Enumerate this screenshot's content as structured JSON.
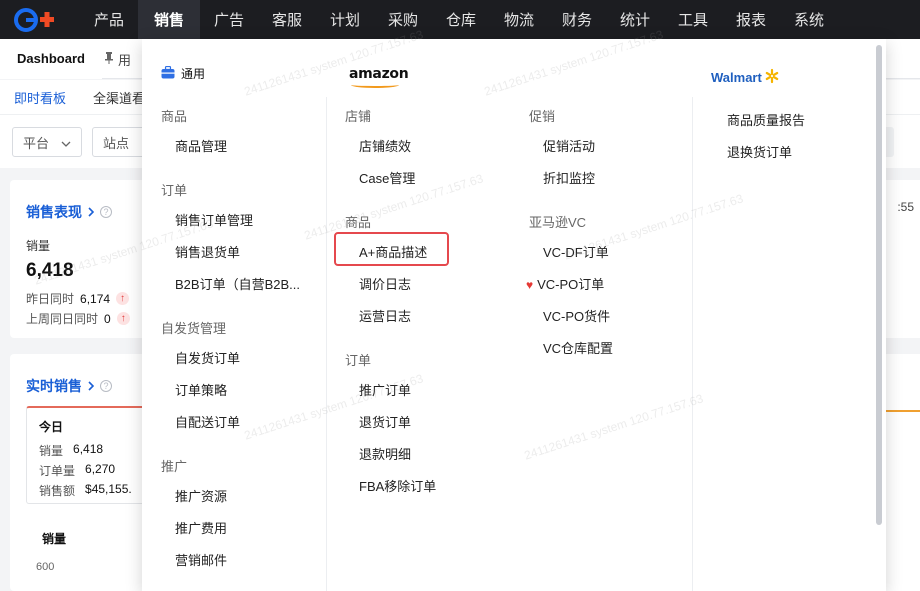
{
  "nav": {
    "items": [
      {
        "label": "产品",
        "active": false
      },
      {
        "label": "销售",
        "active": true
      },
      {
        "label": "广告",
        "active": false
      },
      {
        "label": "客服",
        "active": false
      },
      {
        "label": "计划",
        "active": false
      },
      {
        "label": "采购",
        "active": false
      },
      {
        "label": "仓库",
        "active": false
      },
      {
        "label": "物流",
        "active": false
      },
      {
        "label": "财务",
        "active": false
      },
      {
        "label": "统计",
        "active": false
      },
      {
        "label": "工具",
        "active": false
      },
      {
        "label": "报表",
        "active": false
      },
      {
        "label": "系统",
        "active": false
      }
    ]
  },
  "tabs": {
    "dashboard": "Dashboard",
    "pinned_fragment": "用"
  },
  "subtabs": {
    "realtime": "即时看板",
    "channel_fragment": "全渠道看"
  },
  "filters": {
    "platform": "平台",
    "site": "站点"
  },
  "sales_card": {
    "title": "销售表现",
    "metric_label": "销量",
    "metric_value": "6,418",
    "yesterday_label": "昨日同时",
    "yesterday_value": "6,174",
    "lastweek_label": "上周同日同时",
    "lastweek_value": "0",
    "time_fragment": ":55"
  },
  "realtime_card": {
    "title": "实时销售",
    "today_title": "今日",
    "rows": [
      {
        "label": "销量",
        "value": "6,418"
      },
      {
        "label": "订单量",
        "value": "6,270"
      },
      {
        "label": "销售额",
        "value": "$45,155."
      }
    ],
    "chart_label": "销量",
    "y_tick": "600"
  },
  "mega": {
    "general": {
      "brand": "通用",
      "groups": [
        {
          "title": "商品",
          "items": [
            "商品管理"
          ]
        },
        {
          "title": "订单",
          "items": [
            "销售订单管理",
            "销售退货单",
            "B2B订单（自营B2B..."
          ]
        },
        {
          "title": "自发货管理",
          "items": [
            "自发货订单",
            "订单策略",
            "自配送订单"
          ]
        },
        {
          "title": "推广",
          "items": [
            "推广资源",
            "推广费用",
            "营销邮件"
          ]
        }
      ]
    },
    "amazon": {
      "brand": "amazon",
      "col1": [
        {
          "title": "店铺",
          "items": [
            "店铺绩效",
            "Case管理"
          ]
        },
        {
          "title": "商品",
          "items": [
            "A+商品描述",
            "调价日志",
            "运营日志"
          ]
        },
        {
          "title": "订单",
          "items": [
            "推广订单",
            "退货订单",
            "退款明细",
            "FBA移除订单"
          ]
        }
      ],
      "col2": [
        {
          "title": "促销",
          "items": [
            "促销活动",
            "折扣监控"
          ]
        },
        {
          "title": "亚马逊VC",
          "items": [
            "VC-DF订单",
            "VC-PO订单",
            "VC-PO货件",
            "VC仓库配置"
          ]
        }
      ]
    },
    "walmart": {
      "brand": "Walmart",
      "items": [
        "商品质量报告",
        "退换货订单"
      ]
    }
  },
  "watermark": "2411261431 system 120.77.157.63",
  "colors": {
    "nav_bg": "#1c1d21",
    "accent": "#1a5fd6",
    "highlight": "#e5484d",
    "amazon_orange": "#f29a1d",
    "walmart_blue": "#1f5fbf"
  }
}
